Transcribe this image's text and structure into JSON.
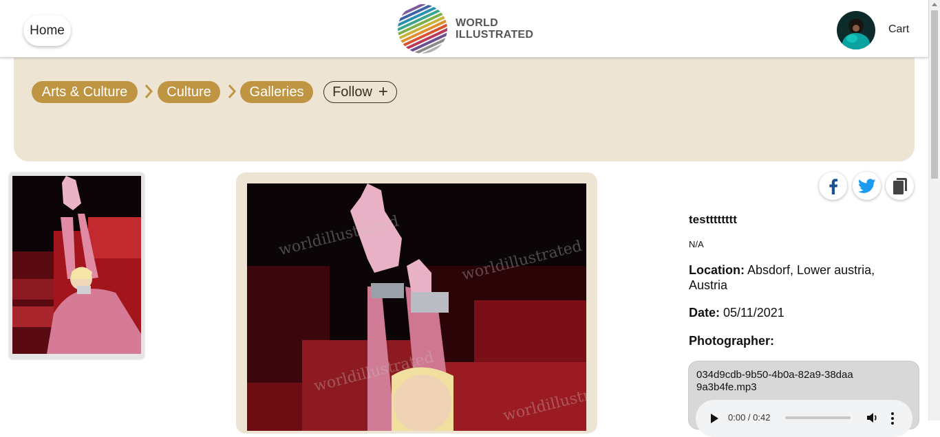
{
  "header": {
    "home_label": "Home",
    "logo_line1": "WORLD",
    "logo_line2": "ILLUSTRATED",
    "cart_label": "Cart"
  },
  "breadcrumb": {
    "items": [
      {
        "label": "Arts & Culture"
      },
      {
        "label": "Culture"
      },
      {
        "label": "Galleries"
      }
    ],
    "follow_label": "Follow",
    "follow_icon": "plus-icon"
  },
  "image": {
    "watermark": "worldillustrated"
  },
  "share": {
    "icons": [
      "facebook-icon",
      "twitter-icon",
      "copy-icon"
    ],
    "facebook_color": "#1b5294",
    "twitter_color": "#1d9bf0"
  },
  "details": {
    "title": "testttttttt",
    "description": "N/A",
    "location_label": "Location:",
    "location_value": "Absdorf, Lower austria, Austria",
    "date_label": "Date:",
    "date_value": "05/11/2021",
    "photographer_label": "Photographer:",
    "photographer_value": ""
  },
  "audio": {
    "filename": "034d9cdb-9b50-4b0a-82a9-38daa9a3b4fe.mp3",
    "time": "0:00 / 0:42",
    "progress": 0
  },
  "colors": {
    "band": "#ede4d4",
    "crumb": "#bf9543"
  }
}
